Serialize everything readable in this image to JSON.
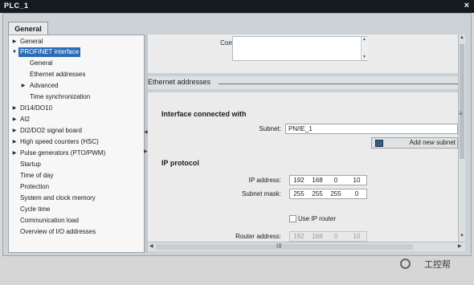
{
  "window": {
    "title": "PLC_1",
    "close_glyph": "×"
  },
  "tab": {
    "label": "General"
  },
  "tree": {
    "items": [
      {
        "label": "General",
        "caret": "▶"
      },
      {
        "label": "PROFINET interface",
        "caret": "▼",
        "selected": true
      },
      {
        "label": "General",
        "caret": ""
      },
      {
        "label": "Ethernet addresses",
        "caret": ""
      },
      {
        "label": "Advanced",
        "caret": "▶"
      },
      {
        "label": "Time synchronization",
        "caret": ""
      },
      {
        "label": "DI14/DO10",
        "caret": "▶"
      },
      {
        "label": "AI2",
        "caret": "▶"
      },
      {
        "label": "DI2/DO2 signal board",
        "caret": "▶"
      },
      {
        "label": "High speed counters (HSC)",
        "caret": "▶"
      },
      {
        "label": "Pulse generators (PTO/PWM)",
        "caret": "▶"
      },
      {
        "label": "Startup",
        "caret": ""
      },
      {
        "label": "Time of day",
        "caret": ""
      },
      {
        "label": "Protection",
        "caret": ""
      },
      {
        "label": "System and clock memory",
        "caret": ""
      },
      {
        "label": "Cycle time",
        "caret": ""
      },
      {
        "label": "Communication load",
        "caret": ""
      },
      {
        "label": "Overview of I/O addresses",
        "caret": ""
      }
    ]
  },
  "comment": {
    "label": "Comment:",
    "value": ""
  },
  "ethernet": {
    "section_title": "Ethernet addresses",
    "interface_heading": "Interface connected with",
    "subnet_label": "Subnet:",
    "subnet_value": "PN/IE_1",
    "add_subnet_label": "Add new subnet"
  },
  "ip": {
    "heading": "IP protocol",
    "address_label": "IP address:",
    "address": [
      "192",
      "168",
      "0",
      "10"
    ],
    "mask_label": "Subnet mask:",
    "mask": [
      "255",
      "255",
      "255",
      "0"
    ],
    "router_checkbox_label": "Use IP router",
    "router_checked": false,
    "router_label": "Router address:",
    "router": [
      "192",
      "168",
      "0",
      "10"
    ]
  },
  "scroll": {
    "h_grip": "III",
    "v_grip": "≡"
  },
  "watermark": {
    "text": "工控帮"
  }
}
